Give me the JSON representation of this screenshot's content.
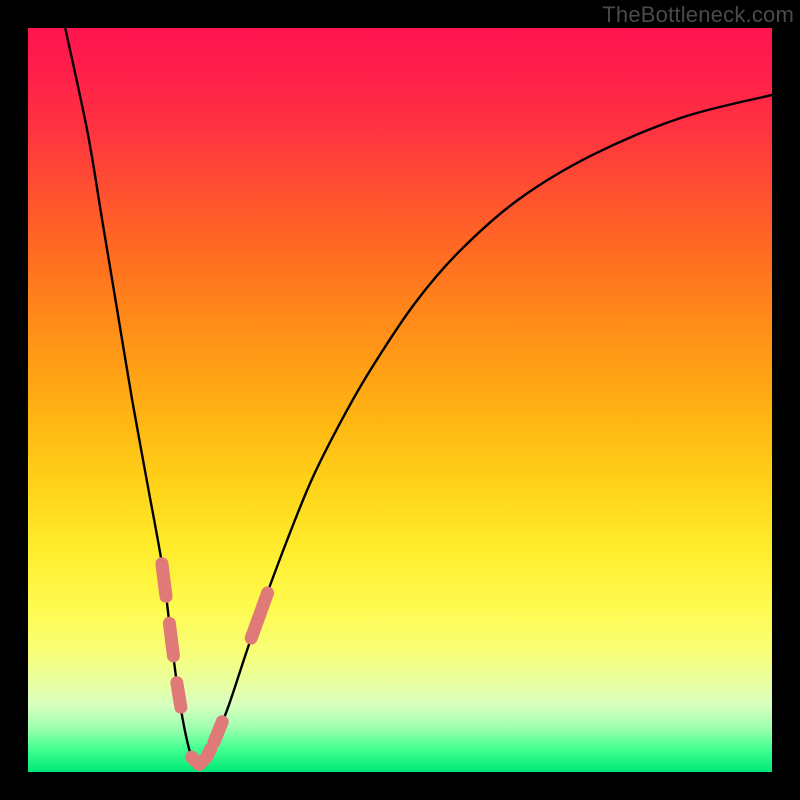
{
  "watermark": "TheBottleneck.com",
  "colors": {
    "gradient_top": "#ff1450",
    "gradient_bottom": "#00e878",
    "curve": "#000000",
    "highlight": "#e07a78",
    "frame": "#000000"
  },
  "chart_data": {
    "type": "line",
    "title": "",
    "xlabel": "",
    "ylabel": "",
    "xlim": [
      0,
      100
    ],
    "ylim": [
      0,
      100
    ],
    "grid": false,
    "notes": "V-shaped bottleneck curve. Y ≈ mismatch percentage (0 at bottom/green). Minimum near x≈22. Pink dashed highlight segments overlay the curve near y≈15–30 on both branches and along the trough.",
    "series": [
      {
        "name": "bottleneck_curve",
        "x": [
          5,
          8,
          10,
          12,
          14,
          16,
          18,
          19,
          20,
          21,
          22,
          23,
          24,
          25,
          27,
          30,
          34,
          38,
          42,
          46,
          52,
          58,
          66,
          76,
          88,
          100
        ],
        "y": [
          100,
          86,
          74,
          62,
          50,
          39,
          28,
          20,
          12,
          6,
          2,
          1,
          2,
          4,
          9,
          18,
          29,
          39,
          47,
          54,
          63,
          70,
          77,
          83,
          88,
          91
        ]
      }
    ],
    "highlight_segments": [
      {
        "branch": "left",
        "y_range": [
          12,
          30
        ]
      },
      {
        "branch": "right",
        "y_range": [
          10,
          25
        ]
      },
      {
        "branch": "trough",
        "y_range": [
          1,
          4
        ]
      }
    ]
  }
}
